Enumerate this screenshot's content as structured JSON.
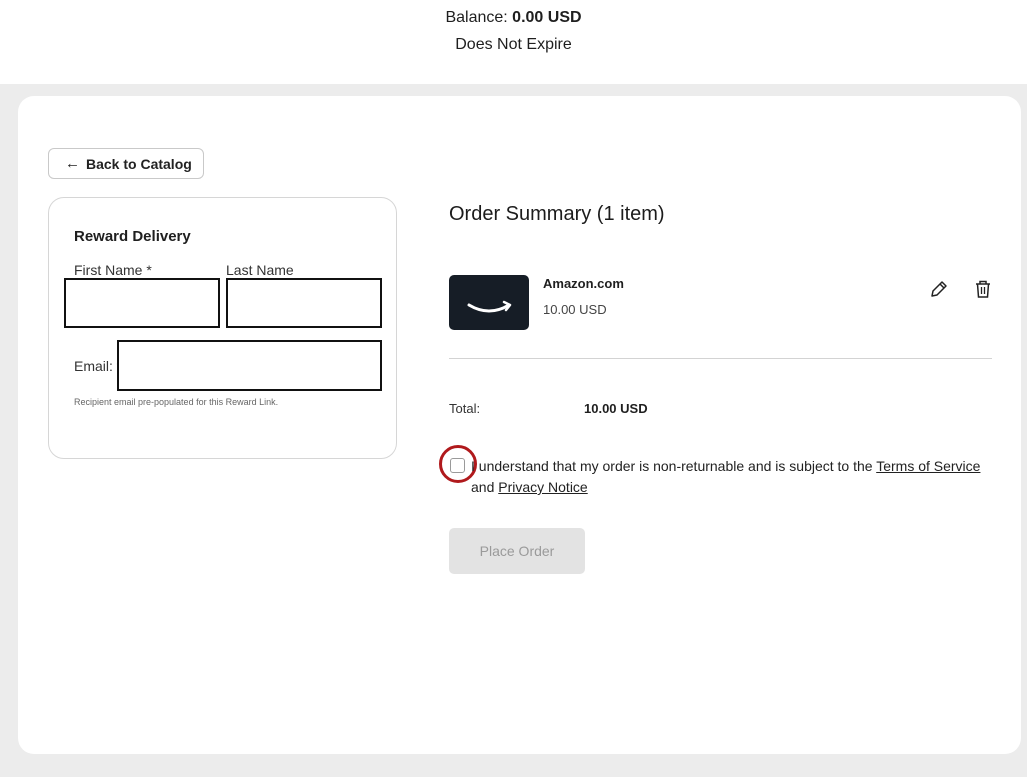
{
  "balance": {
    "label": "Balance:",
    "amount": "0.00 USD",
    "expiry": "Does Not Expire"
  },
  "back_button": {
    "label": "Back to Catalog",
    "icon": "arrow-left-icon"
  },
  "delivery": {
    "title": "Reward Delivery",
    "first_name_label": "First Name *",
    "last_name_label": "Last Name",
    "email_label": "Email: f",
    "note": "Recipient email pre-populated for this Reward Link."
  },
  "summary": {
    "title": "Order Summary (1 item)",
    "item": {
      "name": "Amazon.com",
      "price": "10.00 USD",
      "logo": "amazon-smile-logo"
    },
    "edit_icon": "pencil-icon",
    "delete_icon": "trash-icon",
    "total_label": "Total:",
    "total_value": "10.00 USD"
  },
  "terms": {
    "prefix": "I understand that my order is non-returnable and is subject to the ",
    "tos_link": "Terms of Service",
    "middle": "and ",
    "privacy_link": "Privacy Notice"
  },
  "place_order": {
    "label": "Place Order"
  },
  "colors": {
    "highlight": "#b0191c",
    "thumb_bg": "#161d26",
    "page_bg": "#ececec",
    "disabled_button": "#e3e3e3"
  }
}
